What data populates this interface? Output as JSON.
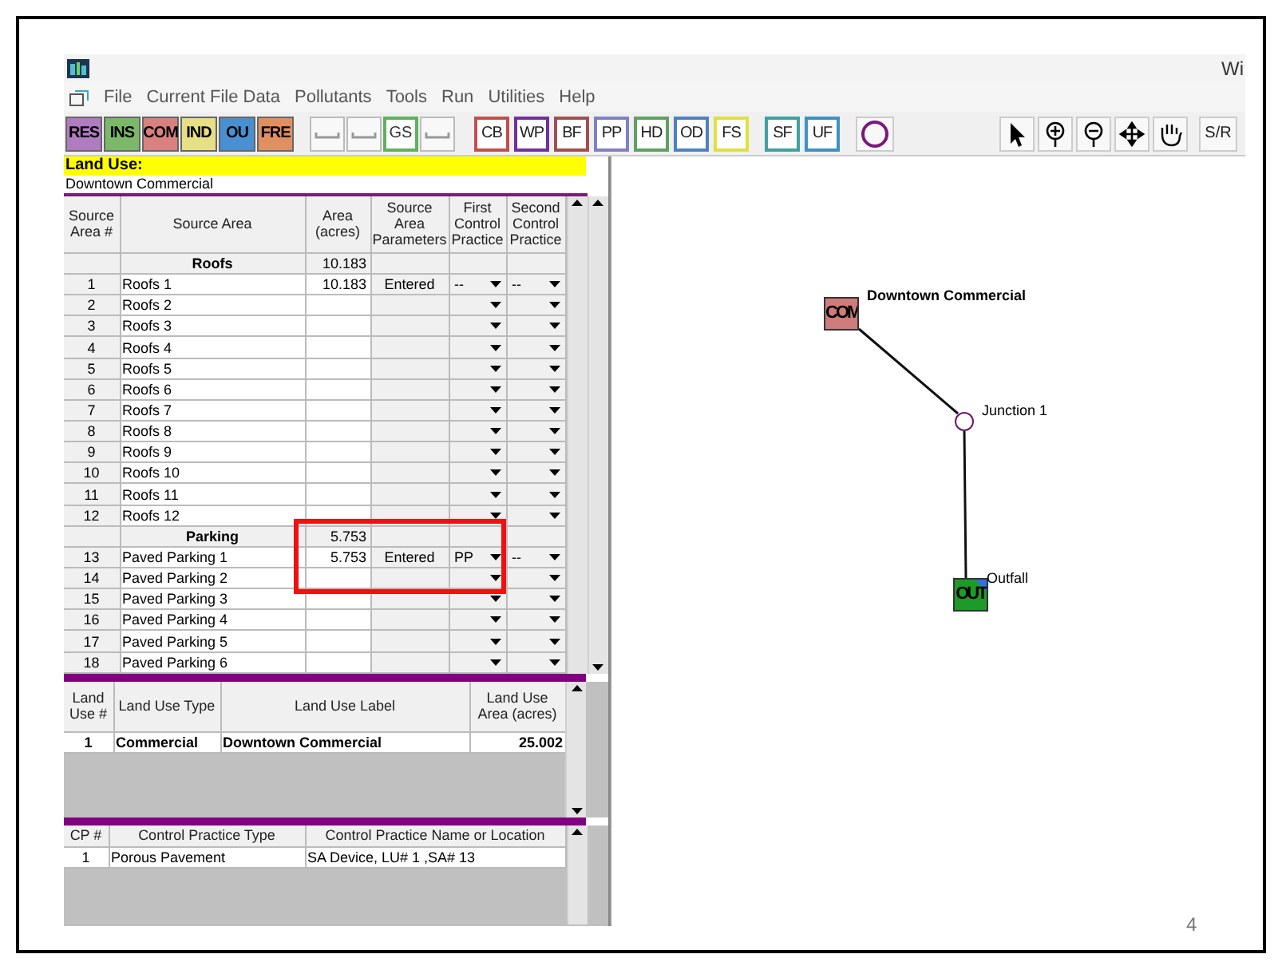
{
  "slide": {
    "page_number": "4"
  },
  "window": {
    "title": "Wi"
  },
  "menu": [
    "File",
    "Current File Data",
    "Pollutants",
    "Tools",
    "Run",
    "Utilities",
    "Help"
  ],
  "toolbar": {
    "land_use_buttons": [
      {
        "label": "RES",
        "color": "#b07cc0"
      },
      {
        "label": "INS",
        "color": "#7cb86a"
      },
      {
        "label": "COM",
        "color": "#d98080"
      },
      {
        "label": "IND",
        "color": "#e6df86"
      },
      {
        "label": "OU",
        "color": "#4a8fd0"
      },
      {
        "label": "FRE",
        "color": "#e09060"
      }
    ],
    "conveyance_buttons": [
      {
        "kind": "drawing"
      },
      {
        "kind": "drawing"
      },
      {
        "kind": "text",
        "label": "GS"
      },
      {
        "kind": "drawing"
      }
    ],
    "control_buttons": [
      {
        "label": "CB",
        "color": "#c0504d"
      },
      {
        "label": "WP",
        "color": "#7030a0"
      },
      {
        "label": "BF",
        "color": "#a05050"
      },
      {
        "label": "PP",
        "color": "#8080c0"
      },
      {
        "label": "HD",
        "color": "#60a060"
      },
      {
        "label": "OD",
        "color": "#4f81bd"
      },
      {
        "label": "FS",
        "color": "#e0e040"
      }
    ],
    "flow_buttons": [
      {
        "label": "SF",
        "color": "#40a0a0"
      },
      {
        "label": "UF",
        "color": "#4090c0"
      }
    ],
    "tools": [
      {
        "kind": "pointer"
      },
      {
        "kind": "zoom_in"
      },
      {
        "kind": "zoom_out"
      },
      {
        "kind": "move"
      },
      {
        "kind": "hand"
      },
      {
        "kind": "text",
        "label": "S/R"
      }
    ]
  },
  "land_use": {
    "heading": "Land Use:",
    "value": "Downtown Commercial"
  },
  "source_areas": {
    "columns": [
      "Source Area #",
      "Source Area",
      "Area (acres)",
      "Source Area Parameters",
      "First Control Practice",
      "Second Control Practice"
    ],
    "rows": [
      {
        "kind": "group",
        "name": "Roofs",
        "area": "10.183"
      },
      {
        "kind": "area",
        "number": "1",
        "name": "Roofs 1",
        "area": "10.183",
        "parameters": "Entered",
        "first_cp": "--",
        "second_cp": "--"
      },
      {
        "kind": "area",
        "number": "2",
        "name": "Roofs 2"
      },
      {
        "kind": "area",
        "number": "3",
        "name": "Roofs 3"
      },
      {
        "kind": "area",
        "number": "4",
        "name": "Roofs 4"
      },
      {
        "kind": "area",
        "number": "5",
        "name": "Roofs 5"
      },
      {
        "kind": "area",
        "number": "6",
        "name": "Roofs 6"
      },
      {
        "kind": "area",
        "number": "7",
        "name": "Roofs 7"
      },
      {
        "kind": "area",
        "number": "8",
        "name": "Roofs 8"
      },
      {
        "kind": "area",
        "number": "9",
        "name": "Roofs 9"
      },
      {
        "kind": "area",
        "number": "10",
        "name": "Roofs 10"
      },
      {
        "kind": "area",
        "number": "11",
        "name": "Roofs 11"
      },
      {
        "kind": "area",
        "number": "12",
        "name": "Roofs 12"
      },
      {
        "kind": "group",
        "name": "Parking",
        "area": "5.753"
      },
      {
        "kind": "area",
        "number": "13",
        "name": "Paved Parking 1",
        "area": "5.753",
        "parameters": "Entered",
        "first_cp": "PP",
        "second_cp": "--"
      },
      {
        "kind": "area",
        "number": "14",
        "name": "Paved Parking 2"
      },
      {
        "kind": "area",
        "number": "15",
        "name": "Paved Parking 3"
      },
      {
        "kind": "area",
        "number": "16",
        "name": "Paved Parking 4"
      },
      {
        "kind": "area",
        "number": "17",
        "name": "Paved Parking 5"
      },
      {
        "kind": "area",
        "number": "18",
        "name": "Paved Parking 6"
      }
    ]
  },
  "land_uses": {
    "columns": [
      "Land Use #",
      "Land Use Type",
      "Land Use Label",
      "Land Use Area (acres)"
    ],
    "rows": [
      {
        "number": "1",
        "type": "Commercial",
        "label": "Downtown Commercial",
        "area": "25.002"
      }
    ]
  },
  "control_practices": {
    "columns": [
      "CP #",
      "Control Practice Type",
      "Control Practice Name or Location"
    ],
    "rows": [
      {
        "number": "1",
        "type": "Porous Pavement",
        "location": "SA Device, LU# 1 ,SA# 13"
      }
    ]
  },
  "diagram": {
    "nodes": [
      {
        "kind": "land_use",
        "symbol": "COM",
        "label": "Downtown Commercial"
      },
      {
        "kind": "junction",
        "label": "Junction 1"
      },
      {
        "kind": "outfall",
        "symbol": "OUT",
        "label": "Outfall"
      }
    ]
  }
}
